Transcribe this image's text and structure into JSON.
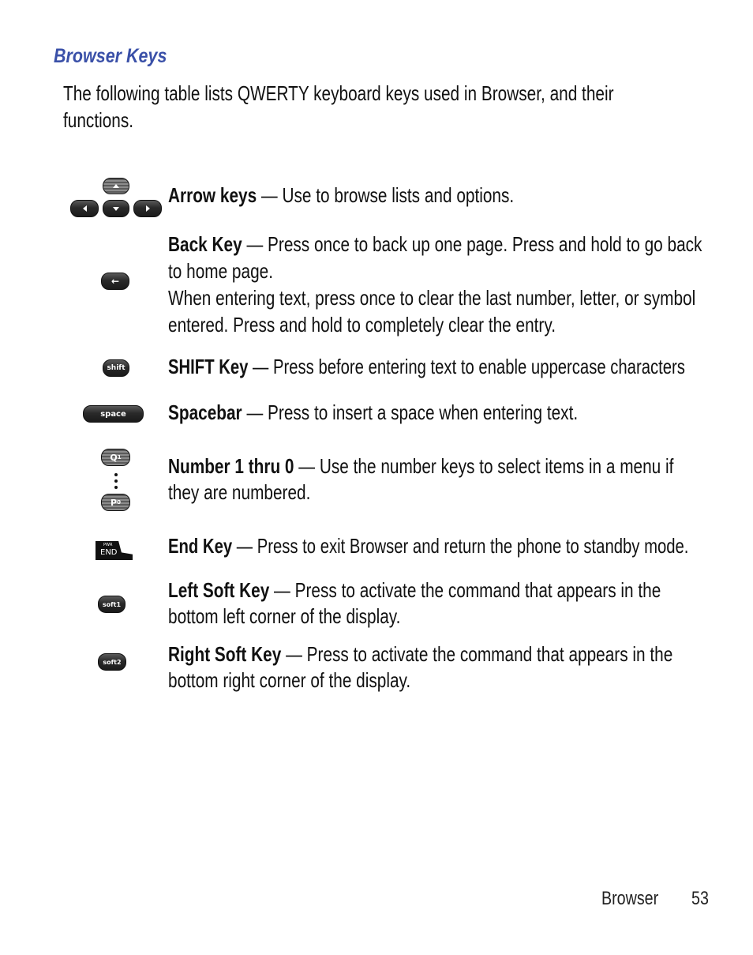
{
  "heading": "Browser Keys",
  "intro": {
    "line1": "The following table lists QWERTY keyboard keys used in Browser, and their",
    "line2": "functions."
  },
  "rows": [
    {
      "icon": "arrow-keys-icon",
      "term": "Arrow keys",
      "dash": " — ",
      "lines": [
        "Use to browse lists and options."
      ]
    },
    {
      "icon": "back-key-icon",
      "term": "Back Key",
      "dash": " — ",
      "lines": [
        "Press once to back up one page. Press and hold to go back",
        "to home page.",
        "When entering text, press once to clear the last number, letter, or symbol",
        "entered. Press and hold to completely clear the entry."
      ]
    },
    {
      "icon": "shift-key-icon",
      "icon_label": "shift",
      "term": "SHIFT Key",
      "dash": " — ",
      "lines": [
        "Press before entering text to enable uppercase characters"
      ]
    },
    {
      "icon": "spacebar-icon",
      "icon_label": "space",
      "term": "Spacebar",
      "dash": " — ",
      "lines": [
        "Press to insert a space when entering text."
      ]
    },
    {
      "icon": "number-keys-icon",
      "icon_label_top": "Q",
      "icon_sup_top": "1",
      "icon_label_bottom": "P",
      "icon_sup_bottom": "0",
      "term": "Number 1 thru  0",
      "dash": " — ",
      "lines": [
        "Use the number keys to select items in a menu if",
        "they are numbered."
      ]
    },
    {
      "icon": "end-key-icon",
      "icon_label_small": "PWR",
      "icon_label": "END",
      "term": "End Key",
      "dash": " — ",
      "lines": [
        "Press to exit Browser and return the phone to standby mode."
      ]
    },
    {
      "icon": "left-soft-key-icon",
      "icon_label": "soft1",
      "term": "Left Soft Key",
      "dash": " — ",
      "lines": [
        "Press to activate the command that appears in the",
        "bottom left corner of the display."
      ]
    },
    {
      "icon": "right-soft-key-icon",
      "icon_label": "soft2",
      "term": "Right Soft Key",
      "dash": " — ",
      "lines": [
        "Press to activate the command that appears in the",
        "bottom right corner of the display."
      ]
    }
  ],
  "footer": {
    "section": "Browser",
    "page": "53"
  },
  "colors": {
    "heading": "#3a50a8",
    "text": "#111111",
    "key": "#2a2a2a"
  }
}
